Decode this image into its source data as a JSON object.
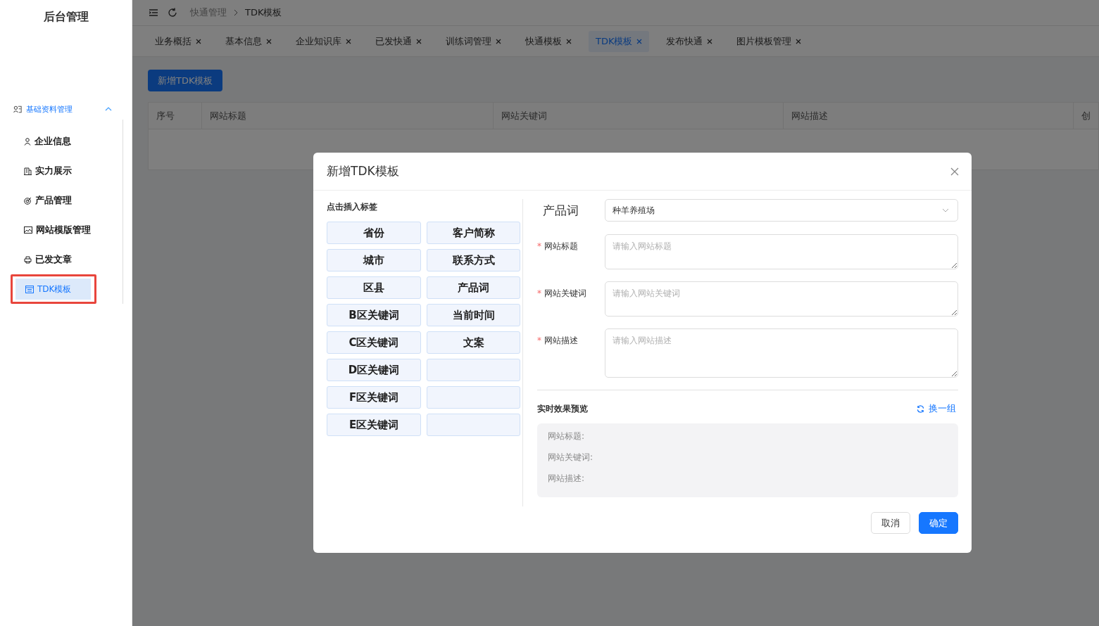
{
  "sidebar": {
    "title": "后台管理",
    "groups": [
      {
        "label": "基础资料管理",
        "expanded": true,
        "children": [
          {
            "label": "企业信息",
            "selected": false
          },
          {
            "label": "实力展示",
            "selected": false
          },
          {
            "label": "产品管理",
            "selected": false
          },
          {
            "label": "网站模版管理",
            "selected": false
          },
          {
            "label": "已发文章",
            "selected": false
          },
          {
            "label": "TDK模板",
            "selected": true,
            "highlighted": true
          }
        ]
      }
    ]
  },
  "breadcrumb": [
    "快通管理",
    "TDK模板"
  ],
  "tabs": [
    {
      "label": "业务概括",
      "selected": false
    },
    {
      "label": "基本信息",
      "selected": false
    },
    {
      "label": "企业知识库",
      "selected": false
    },
    {
      "label": "已发快通",
      "selected": false
    },
    {
      "label": "训练词管理",
      "selected": false
    },
    {
      "label": "快通模板",
      "selected": false
    },
    {
      "label": "TDK模板",
      "selected": true
    },
    {
      "label": "发布快通",
      "selected": false
    },
    {
      "label": "图片模板管理",
      "selected": false
    }
  ],
  "add_button": "新增TDK模板",
  "table": {
    "columns": [
      "序号",
      "网站标题",
      "网站关键词",
      "网站描述",
      "创"
    ]
  },
  "dialog": {
    "title": "新增TDK模板",
    "tags_heading": "点击插入标签",
    "tags": [
      {
        "kind": "tag",
        "label": "省份"
      },
      {
        "kind": "tag",
        "label": "客户简称"
      },
      {
        "kind": "tag",
        "label": "城市"
      },
      {
        "kind": "tag",
        "label": "联系方式"
      },
      {
        "kind": "tag",
        "label": "区县"
      },
      {
        "kind": "tag",
        "label": "产品词"
      },
      {
        "kind": "tag",
        "label": "B区关键词"
      },
      {
        "kind": "tag",
        "label": "当前时间"
      },
      {
        "kind": "tag",
        "label": "C区关键词"
      },
      {
        "kind": "tag",
        "label": "文案"
      },
      {
        "kind": "tag",
        "label": "D区关键词"
      },
      {
        "kind": "blank"
      },
      {
        "kind": "tag",
        "label": "F区关键词"
      },
      {
        "kind": "blank"
      },
      {
        "kind": "tag",
        "label": "E区关键词"
      },
      {
        "kind": "blank"
      }
    ],
    "product_word": {
      "label": "产品词",
      "value": "种羊养殖场"
    },
    "required_mark": "*",
    "fields": [
      {
        "label": "网站标题",
        "required": true,
        "placeholder": "请输入网站标题"
      },
      {
        "label": "网站关键词",
        "required": true,
        "placeholder": "请输入网站关键词"
      },
      {
        "label": "网站描述",
        "required": true,
        "placeholder": "请输入网站描述"
      }
    ],
    "preview": {
      "heading": "实时效果预览",
      "refresh": "换一组",
      "lines": [
        "网站标题:",
        "网站关键词:",
        "网站描述:"
      ]
    },
    "buttons": [
      {
        "label": "取消",
        "kind": "default"
      },
      {
        "label": "确定",
        "kind": "primary"
      }
    ]
  }
}
